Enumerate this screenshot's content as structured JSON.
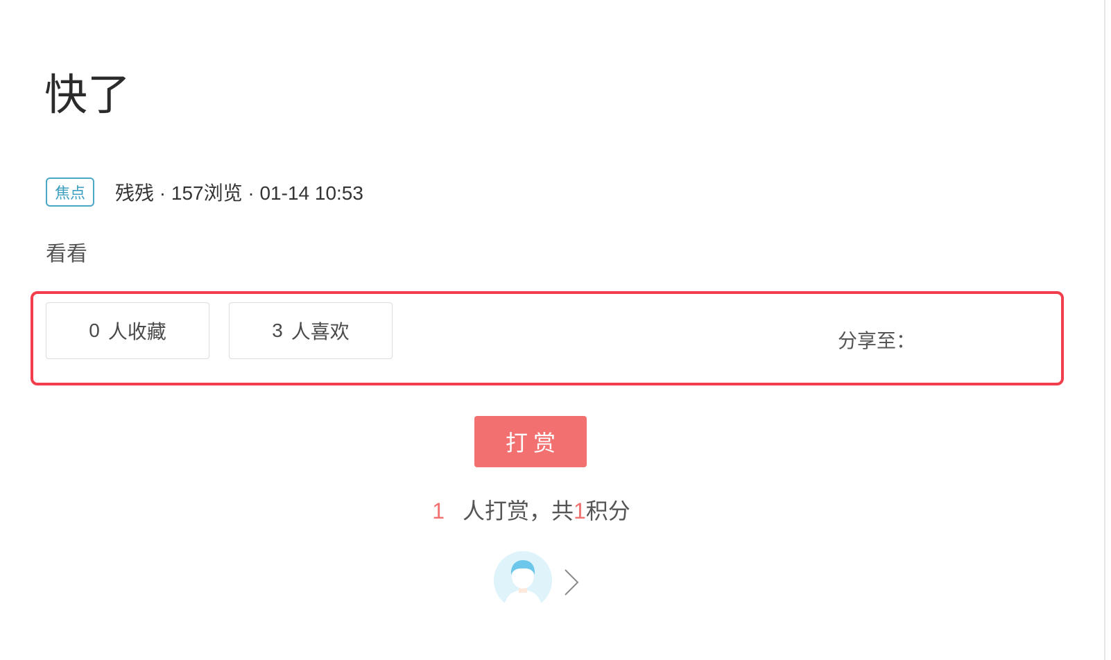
{
  "post": {
    "title": "快了",
    "tag": "焦点",
    "author": "残残",
    "views": "157浏览",
    "time": "01-14 10:53",
    "meta_line": "残残 · 157浏览 · 01-14 10:53",
    "body": "看看"
  },
  "actions": {
    "favorites": {
      "count": "0",
      "label": "人收藏"
    },
    "likes": {
      "count": "3",
      "label": "人喜欢"
    },
    "share_label": "分享至："
  },
  "reward": {
    "button_label": "打赏",
    "people_count": "1",
    "people_label": "人打赏，共",
    "points_count": "1",
    "points_label": "积分"
  },
  "colors": {
    "highlight_border": "#f23d4c",
    "reward": "#f2706f",
    "tag": "#4aa7c6"
  },
  "icons": {
    "avatar": "default-user-avatar-icon",
    "more": "chevron-right-icon"
  }
}
